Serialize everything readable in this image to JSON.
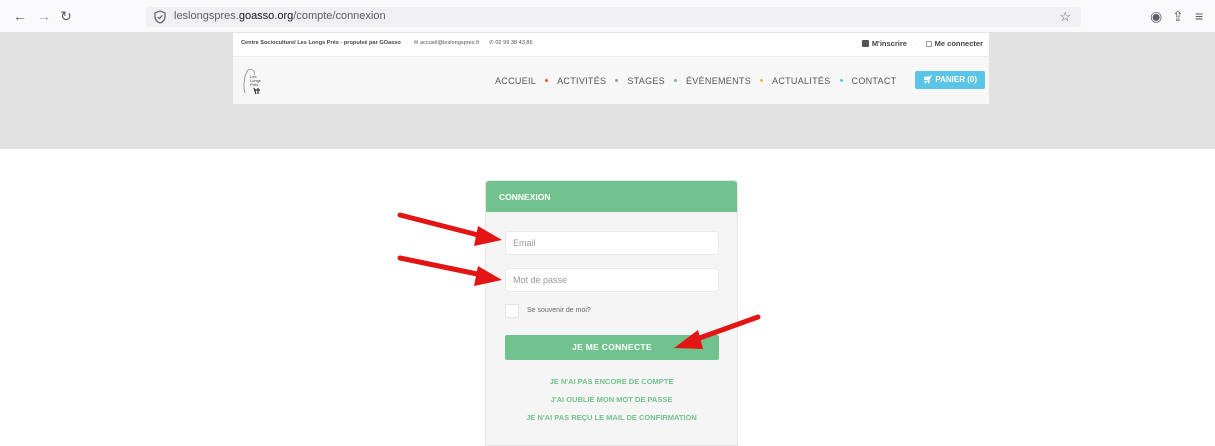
{
  "browser": {
    "url_prefix": "leslongspres.",
    "url_domain": "goasso.org",
    "url_path": "/compte/connexion"
  },
  "topbar": {
    "org": "Centre Socioculturel Les Longs Prés - propulsé par GOasso",
    "email": "accueil@leslongspres.fr",
    "phone": "02 99 38 43 86",
    "signup": "M'inscrire",
    "login": "Me connecter"
  },
  "logo": {
    "line1": "Les",
    "line2": "Longs",
    "line3": "Prés"
  },
  "nav": {
    "items": [
      {
        "label": "ACCUEIL",
        "dot_color": "#e8572f"
      },
      {
        "label": "ACTIVITÉS",
        "dot_color": "#9a9a9a"
      },
      {
        "label": "STAGES",
        "dot_color": "#71c28d"
      },
      {
        "label": "ÉVÈNEMENTS",
        "dot_color": "#f0b341"
      },
      {
        "label": "ACTUALITÉS",
        "dot_color": "#5bc5e8"
      },
      {
        "label": "CONTACT",
        "dot_color": ""
      }
    ],
    "cart": "PANIER (0)"
  },
  "login": {
    "title": "CONNEXION",
    "email_placeholder": "Email",
    "password_placeholder": "Mot de passe",
    "remember": "Se souvenir de moi?",
    "submit": "JE ME CONNECTE",
    "no_account": "JE N'AI PAS ENCORE DE COMPTE",
    "forgot": "J'AI OUBLIÉ MON MOT DE PASSE",
    "no_mail": "JE N'AI PAS REÇU LE MAIL DE CONFIRMATION"
  },
  "colors": {
    "accent_green": "#71c28d",
    "cart_blue": "#5bc5e8",
    "annotation_red": "#e31414"
  }
}
